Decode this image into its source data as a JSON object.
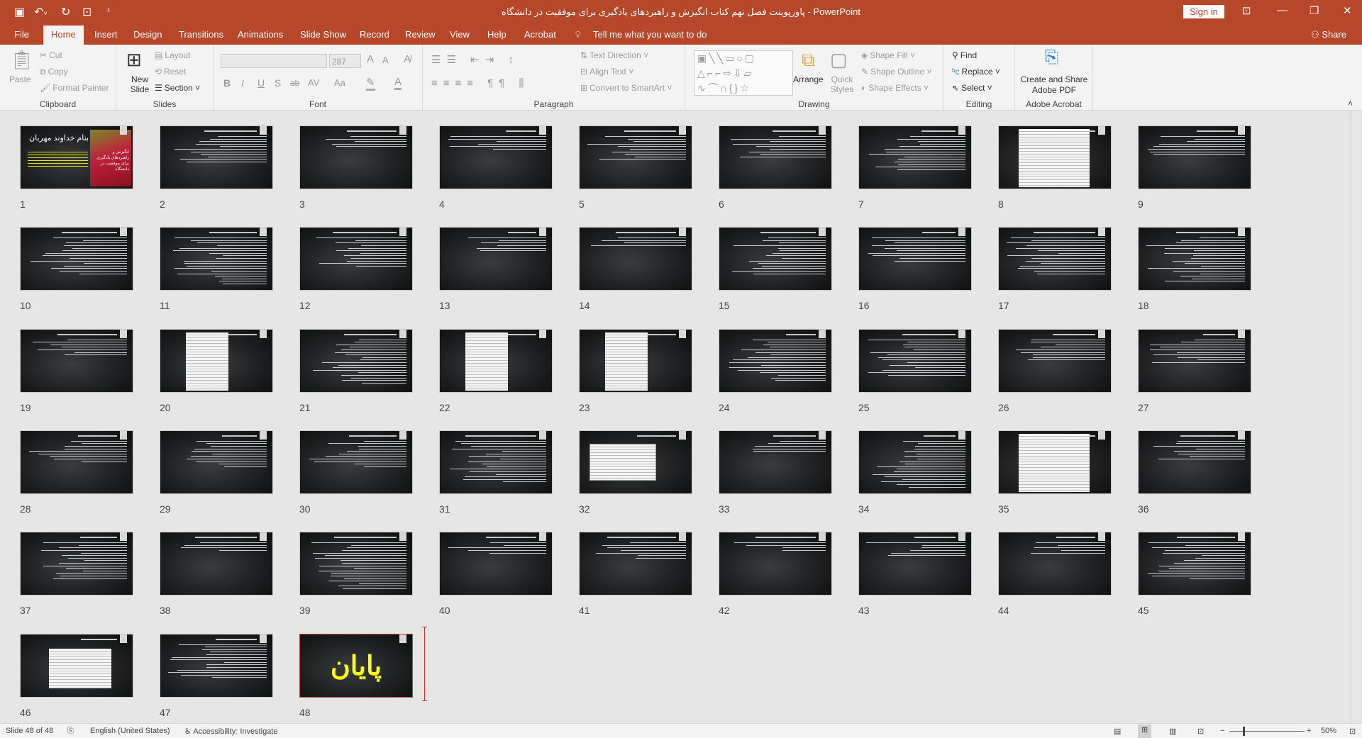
{
  "titlebar": {
    "title": "پاورپوینت فصل نهم کتاب انگیزش و راهبردهای یادگیری برای موفقیت در دانشگاه  -  PowerPoint",
    "sign_in": "Sign in",
    "icons": [
      "save-icon",
      "undo-icon",
      "redo-icon",
      "start-presentation-icon",
      "customize-qat-icon",
      "ribbon-display-icon",
      "minimize-icon",
      "restore-icon",
      "close-icon"
    ]
  },
  "tabs": [
    {
      "label": "File"
    },
    {
      "label": "Home"
    },
    {
      "label": "Insert"
    },
    {
      "label": "Design"
    },
    {
      "label": "Transitions"
    },
    {
      "label": "Animations"
    },
    {
      "label": "Slide Show"
    },
    {
      "label": "Record"
    },
    {
      "label": "Review"
    },
    {
      "label": "View"
    },
    {
      "label": "Help"
    },
    {
      "label": "Acrobat"
    }
  ],
  "active_tab": "Home",
  "tell_me": "Tell me what you want to do",
  "share": "Share",
  "ribbon": {
    "clipboard": {
      "label": "Clipboard",
      "paste": "Paste",
      "cut": "Cut",
      "copy": "Copy",
      "format_painter": "Format Painter"
    },
    "slides": {
      "label": "Slides",
      "new_slide": "New Slide",
      "layout": "Layout",
      "reset": "Reset",
      "section": "Section"
    },
    "font": {
      "label": "Font",
      "font_name": "",
      "font_size": "287",
      "bold": "B",
      "italic": "I",
      "underline": "U",
      "shadow": "S",
      "strike": "ab",
      "spacing": "AV",
      "case": "Aa",
      "grow": "A",
      "shrink": "A"
    },
    "paragraph": {
      "label": "Paragraph",
      "text_direction": "Text Direction",
      "align_text": "Align Text",
      "convert_smartart": "Convert to SmartArt"
    },
    "drawing": {
      "label": "Drawing",
      "arrange": "Arrange",
      "quick_styles": "Quick Styles",
      "shape_fill": "Shape Fill",
      "shape_outline": "Shape Outline",
      "shape_effects": "Shape Effects"
    },
    "editing": {
      "label": "Editing",
      "find": "Find",
      "replace": "Replace",
      "select": "Select"
    },
    "acrobat": {
      "label": "Adobe Acrobat",
      "create_share": "Create and Share Adobe PDF"
    }
  },
  "slides": {
    "count": 48,
    "selected": 48,
    "slide1": {
      "title": "بنام خداوند مهربان",
      "book": "انگیزش و راهبردهای یادگیری برای موفقیت در دانشگاه"
    },
    "slide48": {
      "title": "پایان"
    },
    "image_slides": [
      8,
      20,
      22,
      23,
      32,
      35,
      46
    ],
    "accent_yellow": "#ffff00"
  },
  "status": {
    "slide": "Slide 48 of 48",
    "language": "English (United States)",
    "accessibility": "Accessibility: Investigate",
    "zoom": "50%"
  },
  "colors": {
    "brand": "#b7472a"
  }
}
